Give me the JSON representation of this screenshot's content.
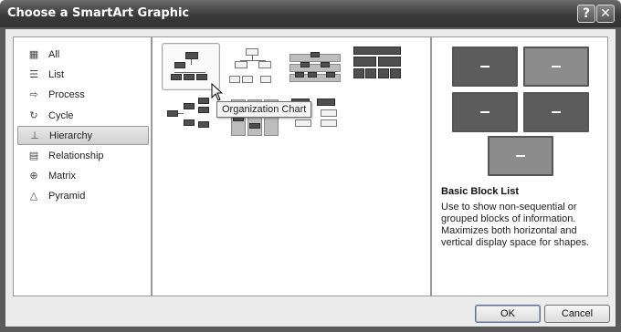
{
  "dialog": {
    "title": "Choose a SmartArt Graphic",
    "help_glyph": "?",
    "close_glyph": "✕"
  },
  "categories": [
    {
      "label": "All",
      "icon": "all-icon",
      "glyph": "▦"
    },
    {
      "label": "List",
      "icon": "list-icon",
      "glyph": "☰"
    },
    {
      "label": "Process",
      "icon": "process-icon",
      "glyph": "⇨"
    },
    {
      "label": "Cycle",
      "icon": "cycle-icon",
      "glyph": "↻"
    },
    {
      "label": "Hierarchy",
      "icon": "hierarchy-icon",
      "glyph": "⊥",
      "selected": true
    },
    {
      "label": "Relationship",
      "icon": "relationship-icon",
      "glyph": "▤"
    },
    {
      "label": "Matrix",
      "icon": "matrix-icon",
      "glyph": "⊕"
    },
    {
      "label": "Pyramid",
      "icon": "pyramid-icon",
      "glyph": "△"
    }
  ],
  "gallery": {
    "tooltip": "Organization Chart"
  },
  "preview": {
    "title": "Basic Block List",
    "description": "Use to show non-sequential or grouped blocks of information. Maximizes both horizontal and vertical display space for shapes."
  },
  "buttons": {
    "ok": "OK",
    "cancel": "Cancel"
  }
}
